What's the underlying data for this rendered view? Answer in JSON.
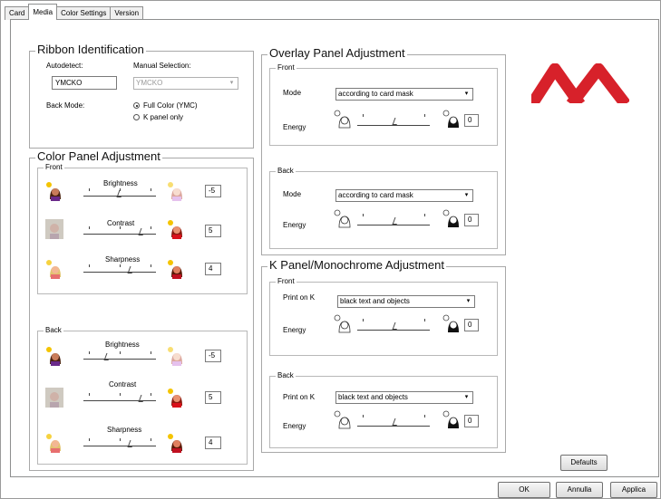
{
  "tabs": [
    "Card",
    "Media",
    "Color Settings",
    "Version"
  ],
  "ribbon": {
    "title": "Ribbon Identification",
    "autodetect_label": "Autodetect:",
    "autodetect_value": "YMCKO",
    "manual_label": "Manual Selection:",
    "manual_value": "YMCKO",
    "back_mode_label": "Back Mode:",
    "option_full": "Full Color (YMC)",
    "option_k": "K panel only"
  },
  "color_panel": {
    "title": "Color Panel Adjustment",
    "front_label": "Front",
    "back_label": "Back",
    "brightness_label": "Brightness",
    "contrast_label": "Contrast",
    "sharpness_label": "Sharpness",
    "front": {
      "brightness": "-5",
      "contrast": "5",
      "sharpness": "4"
    },
    "back": {
      "brightness": "-5",
      "contrast": "5",
      "sharpness": "4"
    }
  },
  "overlay": {
    "title": "Overlay Panel Adjustment",
    "front_label": "Front",
    "back_label": "Back",
    "mode_label": "Mode",
    "energy_label": "Energy",
    "front_mode": "according to card mask",
    "front_energy": "0",
    "back_mode": "according to card mask",
    "back_energy": "0"
  },
  "kpanel": {
    "title": "K Panel/Monochrome Adjustment",
    "front_label": "Front",
    "back_label": "Back",
    "print_label": "Print on K",
    "energy_label": "Energy",
    "front_print": "black text and objects",
    "front_energy": "0",
    "back_print": "black text and objects",
    "back_energy": "0"
  },
  "buttons": {
    "defaults": "Defaults",
    "ok": "OK",
    "cancel": "Annulla",
    "apply": "Applica"
  },
  "logo_color": "#d7212a"
}
